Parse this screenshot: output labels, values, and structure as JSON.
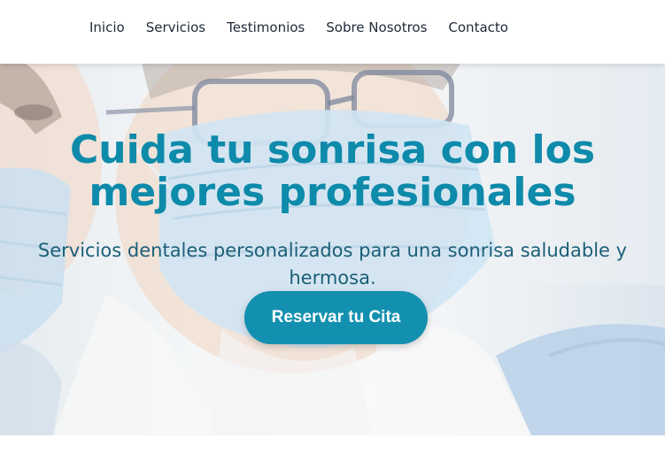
{
  "nav": {
    "items": [
      {
        "label": "Inicio"
      },
      {
        "label": "Servicios"
      },
      {
        "label": "Testimonios"
      },
      {
        "label": "Sobre Nosotros"
      },
      {
        "label": "Contacto"
      }
    ]
  },
  "hero": {
    "title": "Cuida tu sonrisa con los mejores profesionales",
    "subtitle": "Servicios dentales personalizados para una sonrisa saludable y hermosa.",
    "cta_label": "Reservar tu Cita",
    "background_image": "dentist-with-face-mask-and-glasses"
  },
  "colors": {
    "accent": "#0e8aaa",
    "button": "#1390b0",
    "subtitle": "#1b5f78",
    "nav_text": "#1f2937"
  }
}
